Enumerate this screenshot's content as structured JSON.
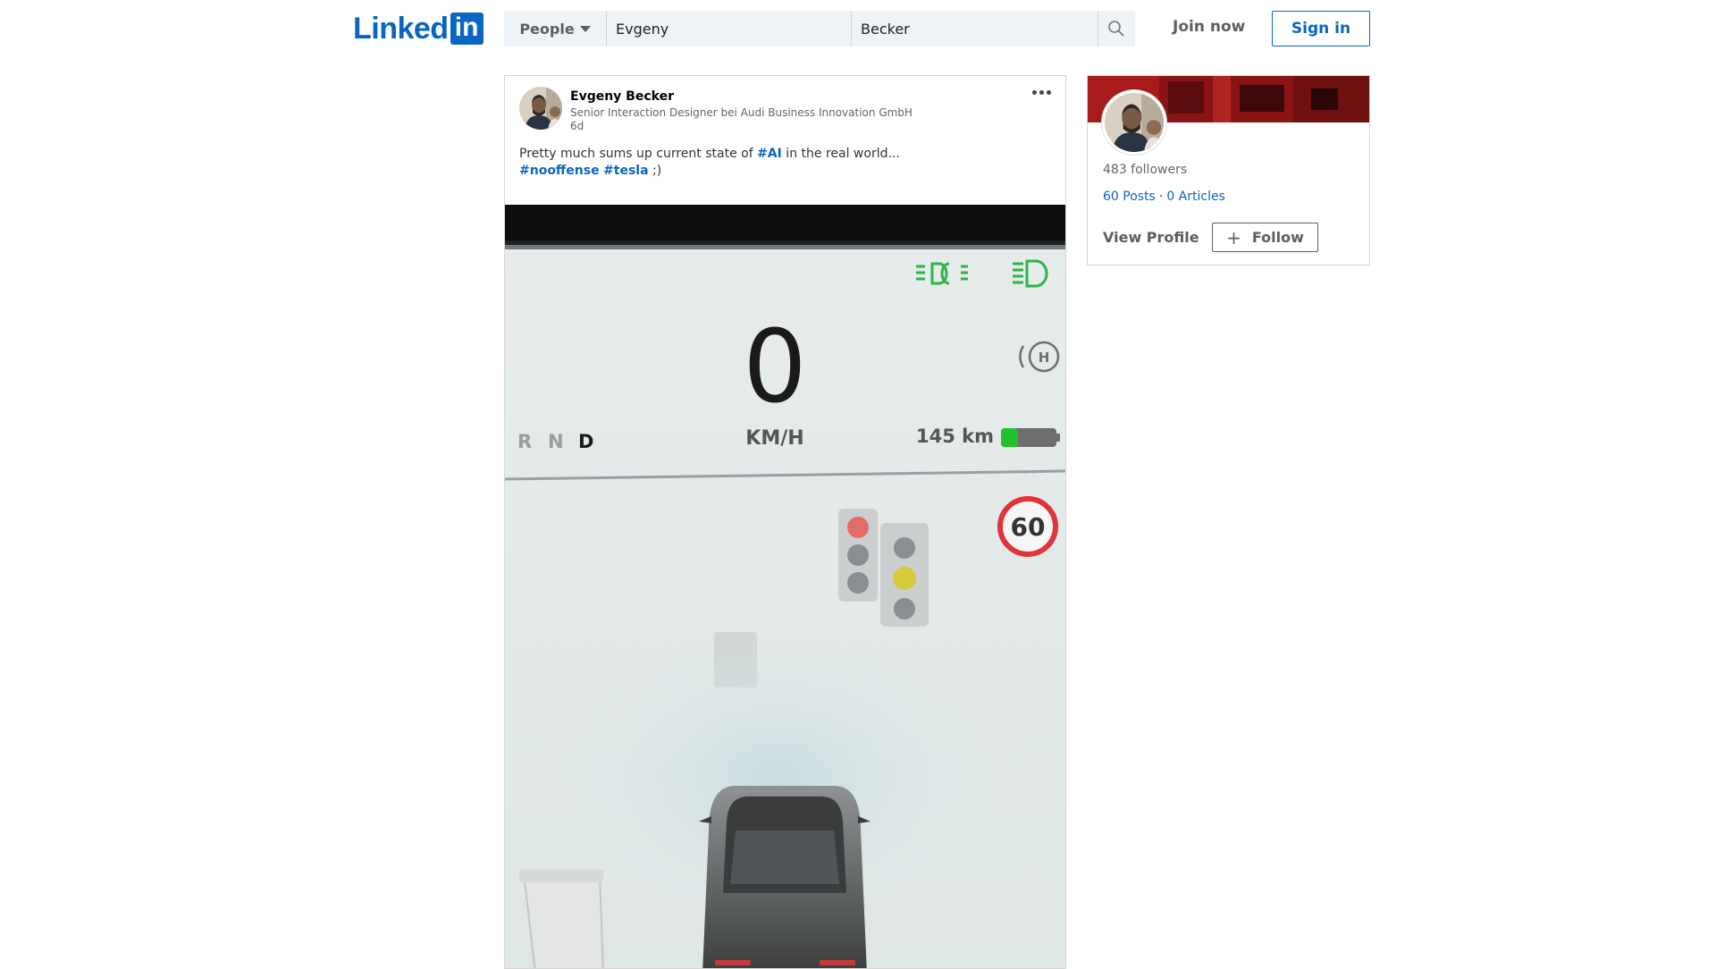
{
  "header": {
    "logo_text": "Linked",
    "logo_box": "in",
    "search_type": "People",
    "first_name_value": "Evgeny",
    "last_name_value": "Becker",
    "join_now": "Join now",
    "sign_in": "Sign in"
  },
  "post": {
    "author_name": "Evgeny Becker",
    "author_headline": "Senior Interaction Designer bei Audi Business Innovation GmbH",
    "time": "6d",
    "text_before": "Pretty much sums up current state of ",
    "hashtag_ai": "#AI",
    "text_after": " in the real world...",
    "hashtag_nooffense": "#nooffense",
    "hashtag_tesla": "#tesla",
    "text_end": " ;)",
    "media": {
      "speed_value": "0",
      "speed_unit": "KM/H",
      "gear_r": "R",
      "gear_n": "N",
      "gear_d": "D",
      "range": "145 km",
      "speed_limit": "60",
      "battery_level": 0.3,
      "colors": {
        "light_indicator": "#2fb34a",
        "battery": "#22c22a",
        "traffic_red": "#e56a6a",
        "traffic_yellow": "#d6c93a",
        "limit_ring": "#e0343a"
      }
    }
  },
  "profile": {
    "followers": "483 followers",
    "posts": "60 Posts",
    "separator": "·",
    "articles": "0 Articles",
    "view_profile": "View Profile",
    "follow": "Follow"
  },
  "colors": {
    "brand": "#0a66c2",
    "banner": "#8a1414"
  }
}
